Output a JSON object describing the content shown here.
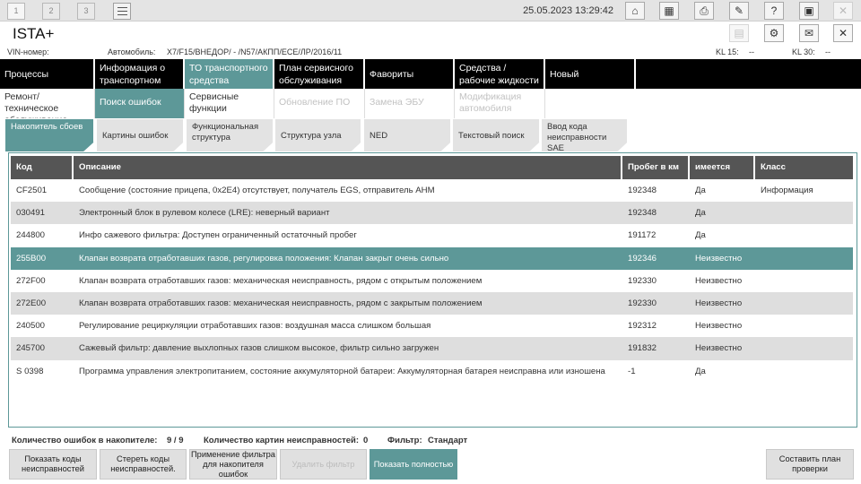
{
  "topbar": {
    "tabs": [
      "1",
      "2",
      "3"
    ],
    "datetime": "25.05.2023 13:29:42"
  },
  "app": {
    "title": "ISTA+"
  },
  "icons": {
    "home": "home-icon",
    "scan": "scan-icon",
    "print": "print-icon",
    "wrench": "wrench-icon",
    "help": "help-icon",
    "download": "download-icon",
    "close": "close-icon",
    "document": "document-icon",
    "gear": "gear-icon",
    "mail": "mail-icon",
    "list": "list-icon"
  },
  "vehicle": {
    "vin_label": "VIN-номер:",
    "car_label": "Автомобиль:",
    "car_value": "X7/F15/ВНЕДОР/ - /N57/АКПП/ЕСЕ/ЛР/2016/11",
    "kl15_label": "KL 15:",
    "kl15_value": "--",
    "kl30_label": "KL 30:",
    "kl30_value": "--"
  },
  "mainnav": [
    {
      "label": "Процессы"
    },
    {
      "label": "Информация о транспортном средстве"
    },
    {
      "label": "ТО транспортного средства"
    },
    {
      "label": "План сервисного обслуживания"
    },
    {
      "label": "Фавориты"
    },
    {
      "label": "Средства / рабочие жидкости"
    },
    {
      "label": "Новый"
    }
  ],
  "subnav": [
    {
      "label": "Ремонт/ техническое обслуживание"
    },
    {
      "label": "Поиск ошибок"
    },
    {
      "label": "Сервисные функции"
    },
    {
      "label": "Обновление ПО"
    },
    {
      "label": "Замена ЭБУ"
    },
    {
      "label": "Модификация автомобиля"
    }
  ],
  "tabs": [
    {
      "label": "Накопитель сбоев"
    },
    {
      "label": "Картины ошибок"
    },
    {
      "label": "Функциональная структура"
    },
    {
      "label": "Структура узла"
    },
    {
      "label": "NED"
    },
    {
      "label": "Текстовый поиск"
    },
    {
      "label": "Ввод кода неисправности SAE"
    }
  ],
  "table": {
    "headers": {
      "code": "Код",
      "desc": "Описание",
      "km": "Пробег в км",
      "has": "имеется",
      "cls": "Класс"
    },
    "rows": [
      {
        "code": "CF2501",
        "desc": "Сообщение (состояние прицепа, 0x2E4) отсутствует, получатель EGS, отправитель AHM",
        "km": "192348",
        "has": "Да",
        "cls": "Информация"
      },
      {
        "code": "030491",
        "desc": "Электронный блок в рулевом колесе (LRE): неверный вариант",
        "km": "192348",
        "has": "Да",
        "cls": ""
      },
      {
        "code": "244800",
        "desc": "Инфо сажевого фильтра: Доступен ограниченный остаточный пробег",
        "km": "191172",
        "has": "Да",
        "cls": ""
      },
      {
        "code": "255B00",
        "desc": "Клапан возврата отработавших газов, регулировка положения: Клапан закрыт очень сильно",
        "km": "192346",
        "has": "Неизвестно",
        "cls": ""
      },
      {
        "code": "272F00",
        "desc": "Клапан возврата отработавших газов: механическая неисправность, рядом с открытым положением",
        "km": "192330",
        "has": "Неизвестно",
        "cls": ""
      },
      {
        "code": "272E00",
        "desc": "Клапан возврата отработавших газов: механическая неисправность, рядом с закрытым положением",
        "km": "192330",
        "has": "Неизвестно",
        "cls": ""
      },
      {
        "code": "240500",
        "desc": "Регулирование рециркуляции отработавших газов: воздушная масса слишком большая",
        "km": "192312",
        "has": "Неизвестно",
        "cls": ""
      },
      {
        "code": "245700",
        "desc": "Сажевый фильтр: давление выхлопных газов слишком высокое, фильтр сильно загружен",
        "km": "191832",
        "has": "Неизвестно",
        "cls": ""
      },
      {
        "code": "S 0398",
        "desc": "Программа управления электропитанием, состояние аккумуляторной батареи: Аккумуляторная батарея неисправна или изношена",
        "km": "-1",
        "has": "Да",
        "cls": ""
      }
    ]
  },
  "status": {
    "faults_label": "Количество ошибок в накопителе:",
    "faults_value": "9 / 9",
    "pictures_label": "Количество картин неисправностей:",
    "pictures_value": "0",
    "filter_label": "Фильтр:",
    "filter_value": "Стандарт"
  },
  "buttons": {
    "show_codes": "Показать коды неисправностей",
    "clear_codes": "Стереть коды неисправностей.",
    "apply_filter": "Применение фильтра для накопителя ошибок",
    "delete_filter": "Удалить фильтр",
    "show_full": "Показать полностью",
    "make_plan": "Составить план проверки"
  }
}
